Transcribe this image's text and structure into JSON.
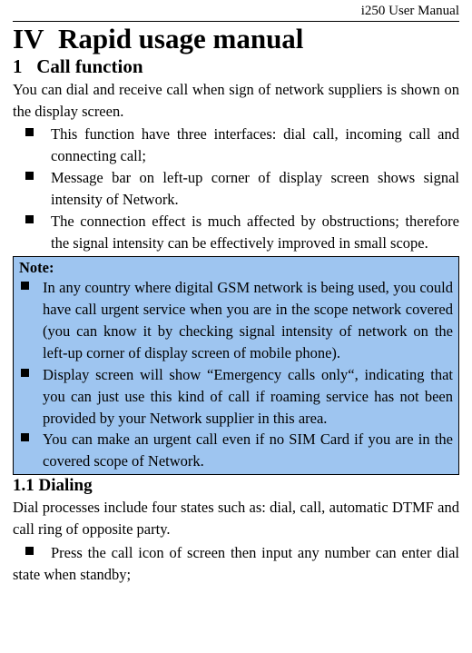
{
  "header": {
    "manual": "i250 User Manual"
  },
  "chapter": {
    "number": "IV",
    "title": "Rapid usage manual"
  },
  "section1": {
    "number": "1",
    "title": "Call function",
    "intro": "You can dial and receive call when sign of network suppliers is shown on the display screen.",
    "bullets": [
      "This function have three interfaces: dial call, incoming call and connecting call;",
      "Message bar on left-up corner of display screen shows signal intensity of Network.",
      "The connection effect is much affected by obstructions; therefore the signal intensity can be effectively improved in small scope."
    ]
  },
  "note": {
    "title": "Note:",
    "bullets": [
      "In any country where digital GSM network is being used, you could have call urgent service when you are in the scope network covered (you can know it by checking signal intensity of network on the left-up corner of display screen of mobile phone).",
      "Display screen will show “Emergency calls only“, indicating that you can just use this kind of call if roaming service has not been provided by your Network supplier in this area.",
      "You can make an urgent call even if no SIM Card if you are in the covered scope of Network."
    ]
  },
  "subsection11": {
    "heading": "1.1 Dialing",
    "intro": "Dial processes include four states such as: dial, call, automatic DTMF and call ring of opposite party.",
    "bullet1": "Press the call icon of screen then input any number can enter dial state when standby;"
  }
}
